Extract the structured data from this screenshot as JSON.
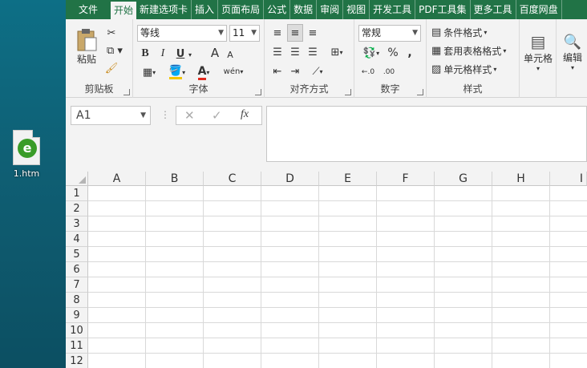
{
  "desktop": {
    "icon_label": "1.htm"
  },
  "ribbon_tabs": [
    "文件",
    "开始",
    "新建选项卡",
    "插入",
    "页面布局",
    "公式",
    "数据",
    "审阅",
    "视图",
    "开发工具",
    "PDF工具集",
    "更多工具",
    "百度网盘"
  ],
  "clipboard": {
    "paste_label": "粘贴",
    "group_label": "剪贴板"
  },
  "font": {
    "name": "等线",
    "size": "11",
    "group_label": "字体",
    "bold": "B",
    "italic": "I",
    "underline": "U",
    "grow": "A",
    "shrink": "A",
    "font_color": "A",
    "phonetic": "wén"
  },
  "alignment": {
    "group_label": "对齐方式"
  },
  "number": {
    "format": "常规",
    "percent": "%",
    "comma": ",",
    "group_label": "数字"
  },
  "styles": {
    "conditional": "条件格式",
    "table_format": "套用表格格式",
    "cell_styles": "单元格样式",
    "group_label": "样式"
  },
  "cells_group": {
    "label": "单元格"
  },
  "editing": {
    "label": "编辑"
  },
  "formula_bar": {
    "name_box": "A1",
    "fx": "fx"
  },
  "columns": [
    "A",
    "B",
    "C",
    "D",
    "E",
    "F",
    "G",
    "H",
    "I"
  ],
  "rows": [
    "1",
    "2",
    "3",
    "4",
    "5",
    "6",
    "7",
    "8",
    "9",
    "10",
    "11",
    "12"
  ],
  "colors": {
    "excel_green": "#217346",
    "ribbon_bg": "#f3f3f3"
  }
}
